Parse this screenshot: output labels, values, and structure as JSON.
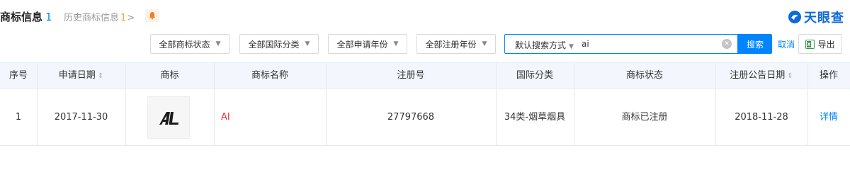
{
  "header": {
    "title": "商标信息",
    "title_count": "1",
    "history_label": "历史商标信息",
    "history_count": "1",
    "history_arrow": ">",
    "bell_icon": "bell-icon",
    "logo_text": "天眼查",
    "accent_color": "#0084ff"
  },
  "filters": {
    "status": "全部商标状态",
    "intl_class": "全部国际分类",
    "apply_year": "全部申请年份",
    "register_year": "全部注册年份",
    "search_mode": "默认搜索方式",
    "search_value": "ai",
    "search_button": "搜索",
    "cancel": "取消",
    "export": "导出"
  },
  "table": {
    "headers": {
      "index": "序号",
      "apply_date": "申请日期",
      "trademark": "商标",
      "name": "商标名称",
      "reg_no": "注册号",
      "intl_class": "国际分类",
      "status": "商标状态",
      "announce_date": "注册公告日期",
      "action": "操作"
    },
    "rows": [
      {
        "index": "1",
        "apply_date": "2017-11-30",
        "trademark_logo_text": "AI",
        "name": "AI",
        "reg_no": "27797668",
        "intl_class": "34类-烟草烟具",
        "status": "商标已注册",
        "announce_date": "2018-11-28",
        "action": "详情"
      }
    ]
  }
}
